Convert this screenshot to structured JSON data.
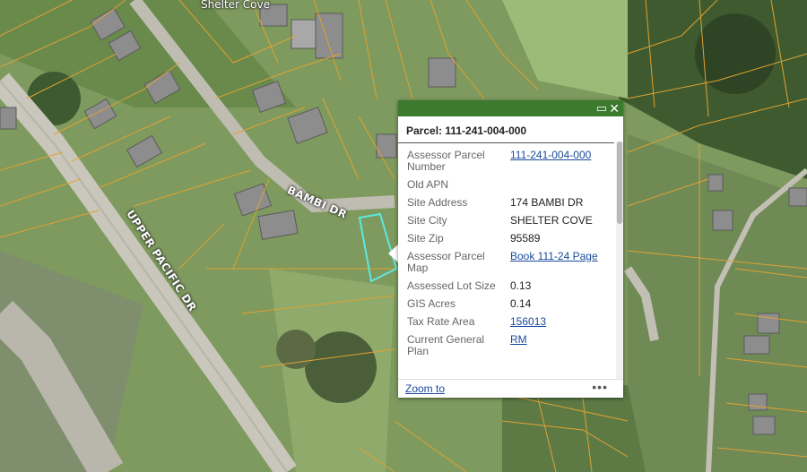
{
  "map": {
    "labels": {
      "shelter_cove": "Shelter Cove",
      "bambi_dr": "BAMBI DR",
      "upper_pacific_dr": "UPPER PACIFIC DR"
    },
    "colors": {
      "parcel_lines": "#e0a232",
      "selected_parcel": "#5ee8e0",
      "road": "#c9c6bb"
    }
  },
  "popup": {
    "title": "Parcel: 111-241-004-000",
    "header_color": "#3c7a2e",
    "icons": [
      "maximize-icon",
      "close-icon",
      "more-icon"
    ],
    "fields": [
      {
        "label": "Assessor Parcel Number",
        "value": "111-241-004-000",
        "link": true
      },
      {
        "label": "Old APN",
        "value": "",
        "link": false
      },
      {
        "label": "Site Address",
        "value": "174 BAMBI DR",
        "link": false
      },
      {
        "label": "Site City",
        "value": "SHELTER COVE",
        "link": false
      },
      {
        "label": "Site Zip",
        "value": "95589",
        "link": false
      },
      {
        "label": "Assessor Parcel Map",
        "value": "Book 111-24 Page",
        "link": true
      },
      {
        "label": "Assessed Lot Size",
        "value": "0.13",
        "link": false
      },
      {
        "label": "GIS Acres",
        "value": "0.14",
        "link": false
      },
      {
        "label": "Tax Rate Area",
        "value": "156013",
        "link": true
      },
      {
        "label": "Current General Plan",
        "value": "RM",
        "link": true
      }
    ],
    "footer": {
      "zoom_label": "Zoom to",
      "more_label": "•••"
    }
  }
}
